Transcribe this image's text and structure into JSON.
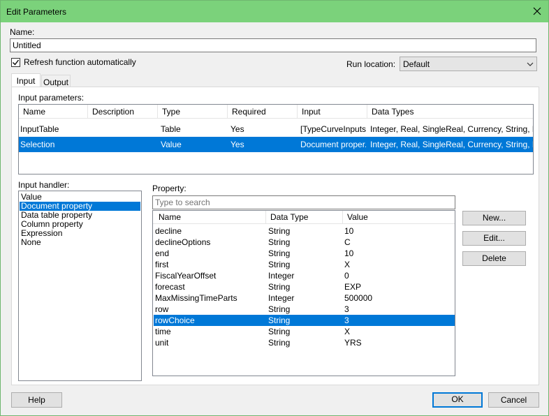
{
  "window": {
    "title": "Edit Parameters"
  },
  "name_label": "Name:",
  "name_value": "Untitled",
  "refresh_label": "Refresh function automatically",
  "run_location_label": "Run location:",
  "run_location_value": "Default",
  "tabs": [
    {
      "label": "Input"
    },
    {
      "label": "Output"
    }
  ],
  "input_params_label": "Input parameters:",
  "params_headers": [
    "Name",
    "Description",
    "Type",
    "Required",
    "Input",
    "Data Types"
  ],
  "params_rows": [
    [
      "InputTable",
      "",
      "Table",
      "Yes",
      "[TypeCurveInputs...",
      "Integer, Real, SingleReal, Currency, String, Da..."
    ],
    [
      "Selection",
      "",
      "Value",
      "Yes",
      "Document proper...",
      "Integer, Real, SingleReal, Currency, String, Da..."
    ]
  ],
  "input_handler_label": "Input handler:",
  "input_handlers": [
    "Value",
    "Document property",
    "Data table property",
    "Column property",
    "Expression",
    "None"
  ],
  "property_label": "Property:",
  "search_placeholder": "Type to search",
  "property_headers": [
    "Name",
    "Data Type",
    "Value"
  ],
  "property_rows": [
    [
      "decline",
      "String",
      "10"
    ],
    [
      "declineOptions",
      "String",
      "C"
    ],
    [
      "end",
      "String",
      "10"
    ],
    [
      "first",
      "String",
      "X"
    ],
    [
      "FiscalYearOffset",
      "Integer",
      "0"
    ],
    [
      "forecast",
      "String",
      "EXP"
    ],
    [
      "MaxMissingTimeParts",
      "Integer",
      "500000"
    ],
    [
      "row",
      "String",
      "3"
    ],
    [
      "rowChoice",
      "String",
      "3"
    ],
    [
      "time",
      "String",
      "X"
    ],
    [
      "unit",
      "String",
      "YRS"
    ]
  ],
  "buttons": {
    "new": "New...",
    "edit": "Edit...",
    "delete": "Delete",
    "help": "Help",
    "ok": "OK",
    "cancel": "Cancel"
  }
}
